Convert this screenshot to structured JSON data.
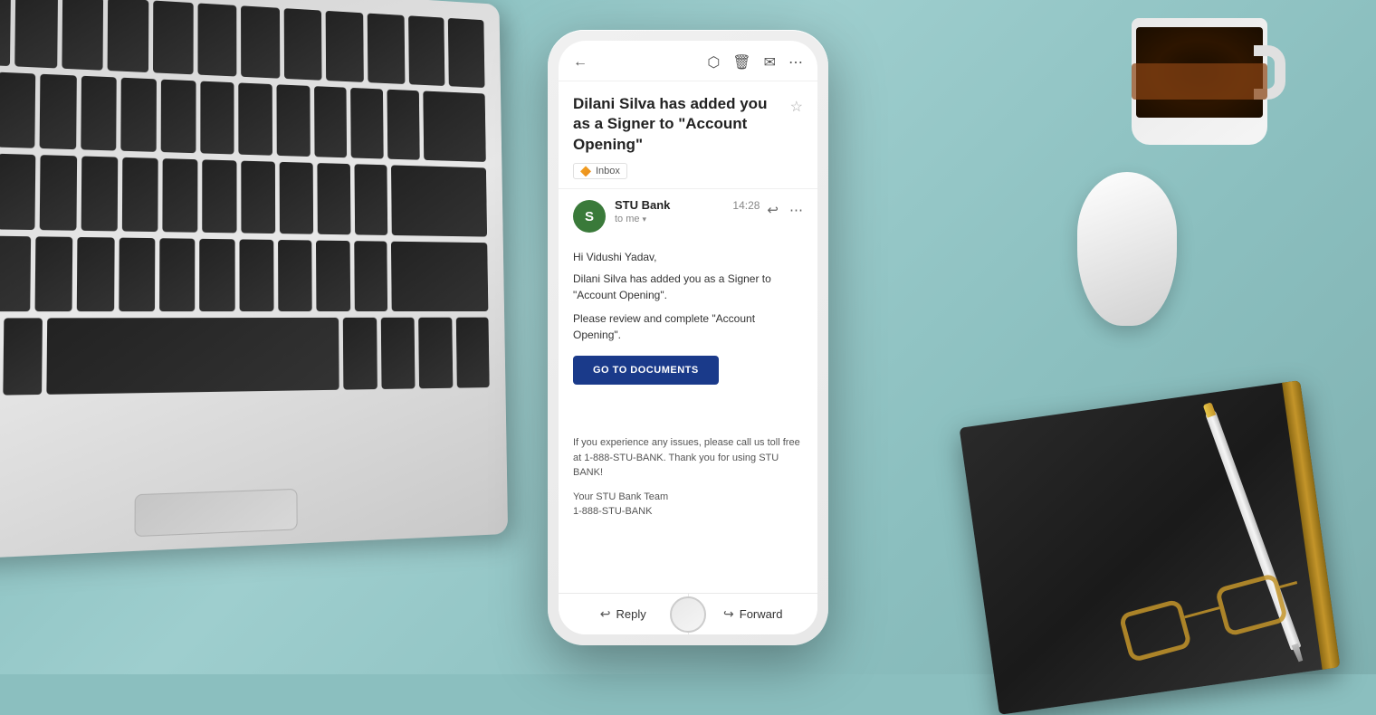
{
  "background": {
    "color": "#8bbfbf"
  },
  "phone": {
    "email": {
      "toolbar": {
        "back_icon": "←",
        "archive_icon": "⬡",
        "delete_icon": "🗑",
        "mail_icon": "✉",
        "more_icon": "⋯"
      },
      "subject": "Dilani Silva has added you as a Signer to \"Account Opening\"",
      "inbox_label": "Inbox",
      "star_icon": "☆",
      "sender": {
        "initial": "S",
        "name": "STU Bank",
        "time": "14:28",
        "to_label": "to me",
        "reply_icon": "↩",
        "more_icon": "⋯"
      },
      "body": {
        "greeting": "Hi Vidushi Yadav,",
        "para1": "Dilani Silva has added you as a Signer to \"Account Opening\".",
        "para2": "Please review and complete \"Account Opening\".",
        "cta_label": "GO TO DOCUMENTS",
        "footer_text": "If you experience any issues, please call us toll free at 1-888-STU-BANK. Thank you for using STU BANK!",
        "team_line1": "Your STU Bank Team",
        "team_line2": "1-888-STU-BANK"
      },
      "actions": {
        "reply_label": "Reply",
        "forward_label": "Forward",
        "reply_icon": "↩",
        "forward_icon": "↪"
      }
    }
  }
}
